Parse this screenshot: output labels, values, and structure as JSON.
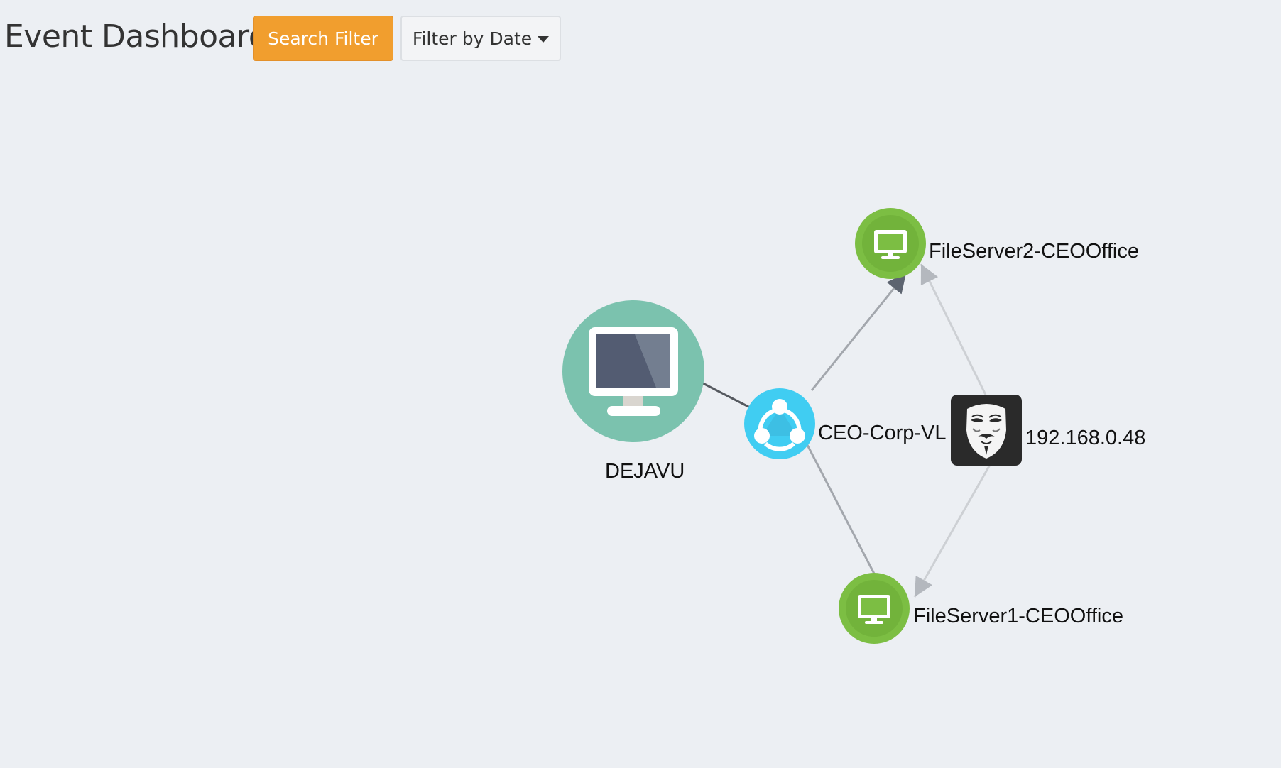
{
  "header": {
    "title": "Event Dashboard",
    "search_filter_label": "Search Filter",
    "filter_by_date_label": "Filter by Date"
  },
  "graph": {
    "nodes": [
      {
        "id": "dejavu",
        "label": "DEJAVU",
        "type": "workstation"
      },
      {
        "id": "ceo-corp-vl",
        "label": "CEO-Corp-VL",
        "type": "network-share"
      },
      {
        "id": "fileserver2",
        "label": "FileServer2-CEOOffice",
        "type": "server"
      },
      {
        "id": "fileserver1",
        "label": "FileServer1-CEOOffice",
        "type": "server"
      },
      {
        "id": "attacker-ip",
        "label": "192.168.0.48",
        "type": "attacker"
      }
    ],
    "edges": [
      {
        "from": "dejavu",
        "to": "ceo-corp-vl",
        "directed": false
      },
      {
        "from": "ceo-corp-vl",
        "to": "fileserver2",
        "directed": true
      },
      {
        "from": "ceo-corp-vl",
        "to": "fileserver1",
        "directed": false
      },
      {
        "from": "attacker-ip",
        "to": "fileserver2",
        "directed": true
      },
      {
        "from": "attacker-ip",
        "to": "fileserver1",
        "directed": true
      }
    ]
  },
  "colors": {
    "background": "#eceff3",
    "accent_orange": "#f19e2e",
    "workstation_teal": "#7bc2ae",
    "server_green": "#7cbe43",
    "share_cyan": "#40cdf2",
    "attacker_dark": "#2a2a2a"
  }
}
